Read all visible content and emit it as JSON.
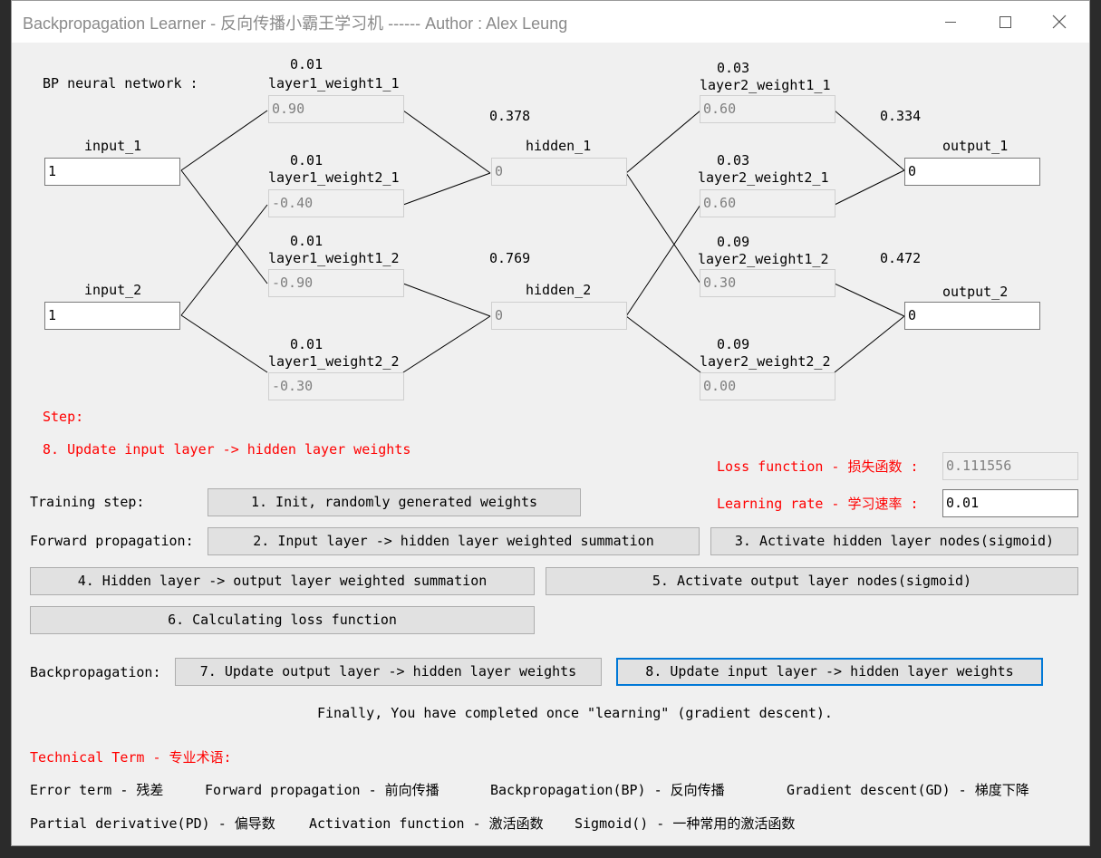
{
  "window": {
    "title": "Backpropagation Learner - 反向传播小霸王学习机 ------ Author : Alex Leung"
  },
  "network": {
    "heading": "BP neural network :",
    "inputs": [
      {
        "label": "input_1",
        "value": "1"
      },
      {
        "label": "input_2",
        "value": "1"
      }
    ],
    "layer1": [
      {
        "grad": "0.01",
        "label": "layer1_weight1_1",
        "value": "0.90"
      },
      {
        "grad": "0.01",
        "label": "layer1_weight2_1",
        "value": "-0.40"
      },
      {
        "grad": "0.01",
        "label": "layer1_weight1_2",
        "value": "-0.90"
      },
      {
        "grad": "0.01",
        "label": "layer1_weight2_2",
        "value": "-0.30"
      }
    ],
    "hidden": [
      {
        "activation": "0.378",
        "label": "hidden_1",
        "value": "0"
      },
      {
        "activation": "0.769",
        "label": "hidden_2",
        "value": "0"
      }
    ],
    "layer2": [
      {
        "grad": "0.03",
        "label": "layer2_weight1_1",
        "value": "0.60"
      },
      {
        "grad": "0.03",
        "label": "layer2_weight2_1",
        "value": "0.60"
      },
      {
        "grad": "0.09",
        "label": "layer2_weight1_2",
        "value": "0.30"
      },
      {
        "grad": "0.09",
        "label": "layer2_weight2_2",
        "value": "0.00"
      }
    ],
    "outputs": [
      {
        "activation": "0.334",
        "label": "output_1",
        "value": "0"
      },
      {
        "activation": "0.472",
        "label": "output_2",
        "value": "0"
      }
    ]
  },
  "step": {
    "heading": "Step:",
    "current": "8. Update input layer -> hidden layer weights"
  },
  "params": {
    "loss_label": "Loss function - 损失函数 :",
    "loss_value": "0.111556",
    "lr_label": "Learning rate - 学习速率 :",
    "lr_value": "0.01"
  },
  "training": {
    "training_label": "Training step:",
    "forward_label": "Forward propagation:",
    "backprop_label": "Backpropagation:",
    "btn1": "1. Init, randomly generated weights",
    "btn2": "2. Input layer -> hidden layer weighted summation",
    "btn3": "3. Activate hidden layer nodes(sigmoid)",
    "btn4": "4. Hidden layer -> output layer weighted summation",
    "btn5": "5. Activate output layer nodes(sigmoid)",
    "btn6": "6. Calculating loss function",
    "btn7": "7. Update output layer -> hidden layer weights",
    "btn8": "8. Update input layer -> hidden layer weights",
    "final_note": "Finally, You have completed once \"learning\" (gradient descent)."
  },
  "terms": {
    "heading": "Technical Term - 专业术语:",
    "t1": "Error term - 残差",
    "t2": "Forward propagation - 前向传播",
    "t3": "Backpropagation(BP) - 反向传播",
    "t4": "Gradient descent(GD) - 梯度下降",
    "t5": "Partial derivative(PD) - 偏导数",
    "t6": "Activation function - 激活函数",
    "t7": "Sigmoid() - 一种常用的激活函数"
  }
}
